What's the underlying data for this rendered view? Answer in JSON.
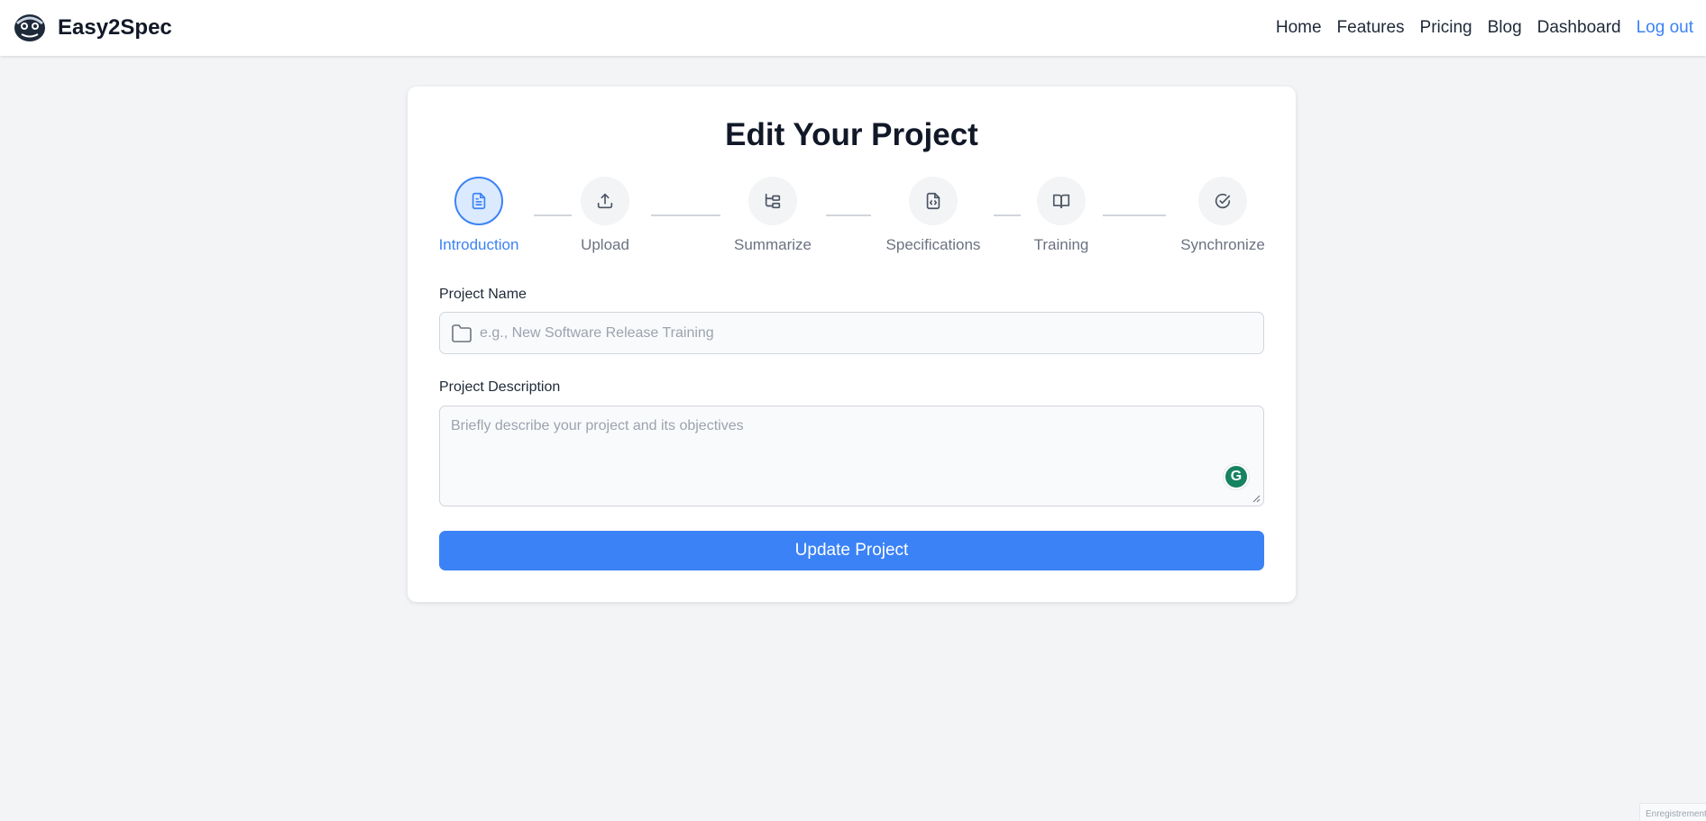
{
  "brand": {
    "name": "Easy2Spec"
  },
  "nav": {
    "items": [
      {
        "label": "Home"
      },
      {
        "label": "Features"
      },
      {
        "label": "Pricing"
      },
      {
        "label": "Blog"
      },
      {
        "label": "Dashboard"
      }
    ],
    "logout": "Log out"
  },
  "page": {
    "title": "Edit Your Project"
  },
  "steps": [
    {
      "label": "Introduction",
      "icon": "file-text-icon",
      "active": true
    },
    {
      "label": "Upload",
      "icon": "upload-icon",
      "active": false
    },
    {
      "label": "Summarize",
      "icon": "folder-tree-icon",
      "active": false
    },
    {
      "label": "Specifications",
      "icon": "file-code-icon",
      "active": false
    },
    {
      "label": "Training",
      "icon": "book-open-icon",
      "active": false
    },
    {
      "label": "Synchronize",
      "icon": "check-circle-icon",
      "active": false
    }
  ],
  "form": {
    "name_label": "Project Name",
    "name_value": "",
    "name_placeholder": "e.g., New Software Release Training",
    "description_label": "Project Description",
    "description_value": "",
    "description_placeholder": "Briefly describe your project and its objectives",
    "submit_label": "Update Project"
  },
  "colors": {
    "accent": "#3b82f6",
    "background": "#f3f4f6",
    "grammarly": "#15835f"
  },
  "footer_badge": "Enregistrement"
}
